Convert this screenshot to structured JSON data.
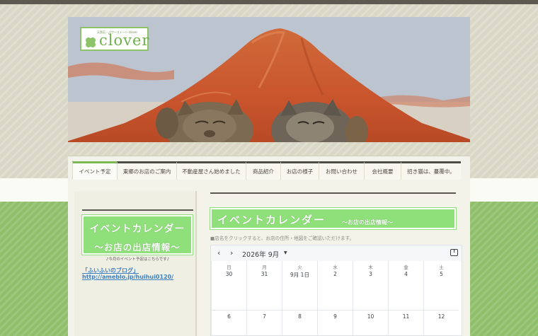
{
  "header": {
    "logo_tagline": "天然石・パワーストーン clover",
    "logo_name": "clover"
  },
  "nav": {
    "items": [
      {
        "label": "イベント予定"
      },
      {
        "label": "東郷のお店のご案内"
      },
      {
        "label": "不動産屋さん始めました"
      },
      {
        "label": "商品紹介"
      },
      {
        "label": "お店の様子"
      },
      {
        "label": "お問い合わせ"
      },
      {
        "label": "会社概要"
      },
      {
        "label": "招き猫は、蔓覆中。"
      }
    ]
  },
  "sidebar": {
    "banner_line1": "イベントカレンダー",
    "banner_line2": "～お店の出店情報～",
    "note": "♪今月のイベント予定はこちらです♪",
    "link1": "「ふいふいのブログ」",
    "link2": "http://ameblo.jp/huihui0120/"
  },
  "main": {
    "banner_title": "イベントカレンダー",
    "banner_sub": "～お店の出店情報～",
    "note": "■店名をクリックすると、お店の住所・地図をご確認いただけます。"
  },
  "calendar": {
    "prev_icon": "‹",
    "next_icon": "›",
    "month_label": "2026年 9月",
    "weekdays": [
      "日",
      "月",
      "火",
      "水",
      "木",
      "金",
      "土"
    ],
    "week1": [
      "30",
      "31",
      "9月 1日",
      "2",
      "3",
      "4",
      "5"
    ],
    "week2": [
      "6",
      "7",
      "8",
      "9",
      "10",
      "11",
      "12"
    ]
  }
}
